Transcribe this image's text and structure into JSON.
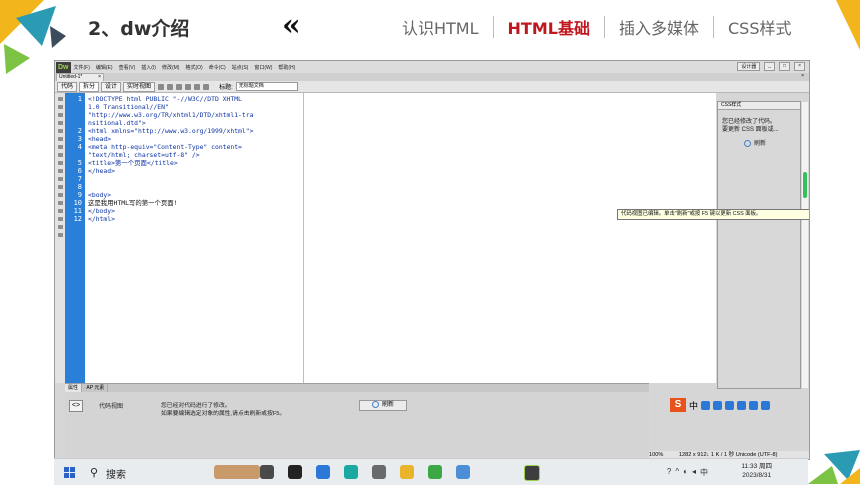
{
  "slide": {
    "title": "2、dw介绍",
    "chevron": "«",
    "nav": [
      "认识HTML",
      "HTML基础",
      "插入多媒体",
      "CSS样式"
    ],
    "active_index": 1,
    "accent": "#c0161d"
  },
  "dw": {
    "logo": "Dw",
    "menu": [
      "文件(F)",
      "编辑(E)",
      "查看(V)",
      "插入(I)",
      "修改(M)",
      "格式(O)",
      "命令(C)",
      "站点(S)",
      "窗口(W)",
      "帮助(H)"
    ],
    "workspace": "设计器",
    "doc_tab": "Untitled-1*",
    "view_buttons": [
      "代码",
      "拆分",
      "设计",
      "实时视图"
    ],
    "title_label": "标题:",
    "title_value": "无标题文档",
    "line_numbers": [
      "1",
      "2",
      "3",
      "4",
      "5",
      "6",
      "7",
      "8",
      "9",
      "10",
      "11",
      "12"
    ],
    "code_lines": [
      "<!DOCTYPE html PUBLIC \"-//W3C//DTD XHTML",
      "1.0 Transitional//EN\"",
      "\"http://www.w3.org/TR/xhtml1/DTD/xhtml1-tra",
      "nsitional.dtd\">",
      "<html xmlns=\"http://www.w3.org/1999/xhtml\">",
      "<head>",
      "<meta http-equiv=\"Content-Type\" content=",
      "\"text/html; charset=utf-8\" />",
      "<title>第一个页面</title>",
      "</head>",
      "",
      "<body>",
      "这是我用HTML写的第一个页面!",
      "</body>",
      "</html>"
    ],
    "css_panel_title": "CSS样式",
    "css_msg_1": "您已经修改了代码。",
    "css_msg_2": "要更新 CSS 面板或...",
    "css_refresh": "刷新",
    "tooltip": "代码视图已编辑。单击\"刷新\"或按 F5 键以更新 CSS 面板。",
    "props_tabs": [
      "属性",
      "AP 元素"
    ],
    "props_label": "代码视图",
    "props_msg_1": "您已经对代码进行了修改。",
    "props_msg_2": "如果要编辑选定对象的属性,请点击刷新或按F5。",
    "props_refresh": "刷新",
    "zoom": "100%",
    "status": "1282 x 912↓ 1 K / 1 秒 Unicode (UTF-8)"
  },
  "taskbar": {
    "search": "搜索",
    "ime": "中",
    "time": "11:33 周四",
    "date": "2023/8/31"
  }
}
